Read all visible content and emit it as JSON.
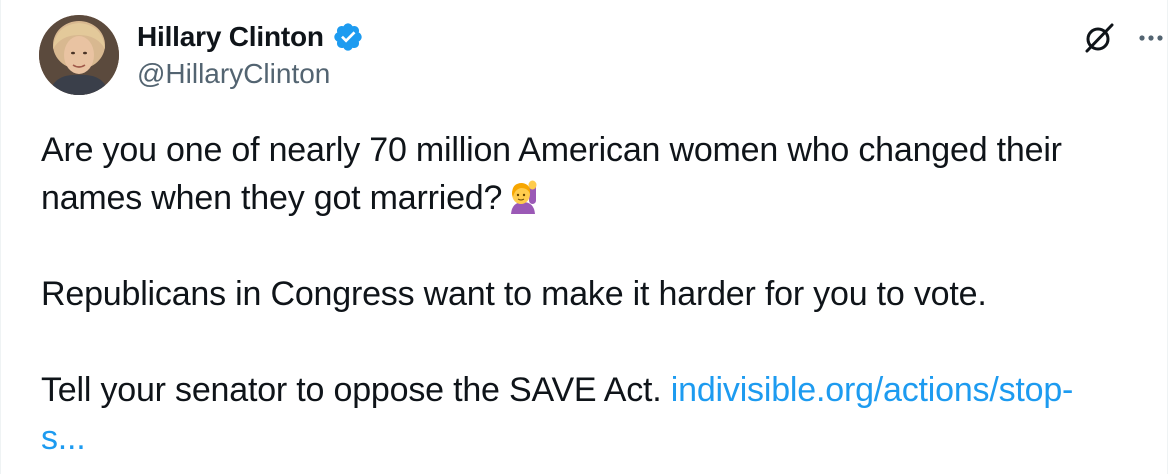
{
  "author": {
    "display_name": "Hillary Clinton",
    "handle": "@HillaryClinton",
    "verified": true,
    "verified_color": "#1d9bf0"
  },
  "icons": {
    "verified": "verified-badge-icon",
    "grok": "grok-icon",
    "more": "more-options-icon",
    "emoji": "woman-raising-hand-emoji"
  },
  "tweet": {
    "line1": "Are you one of nearly 70 million American women who changed their",
    "line2": "names when they got married?",
    "paragraph2": "Republicans in Congress want to make it harder for you to vote.",
    "paragraph3_text": "Tell your senator to oppose the SAVE Act. ",
    "link_part1": "indivisible.org/actions/stop-",
    "link_part2": "s..."
  },
  "colors": {
    "text": "#0f1419",
    "secondary": "#536471",
    "link": "#1d9bf0"
  }
}
